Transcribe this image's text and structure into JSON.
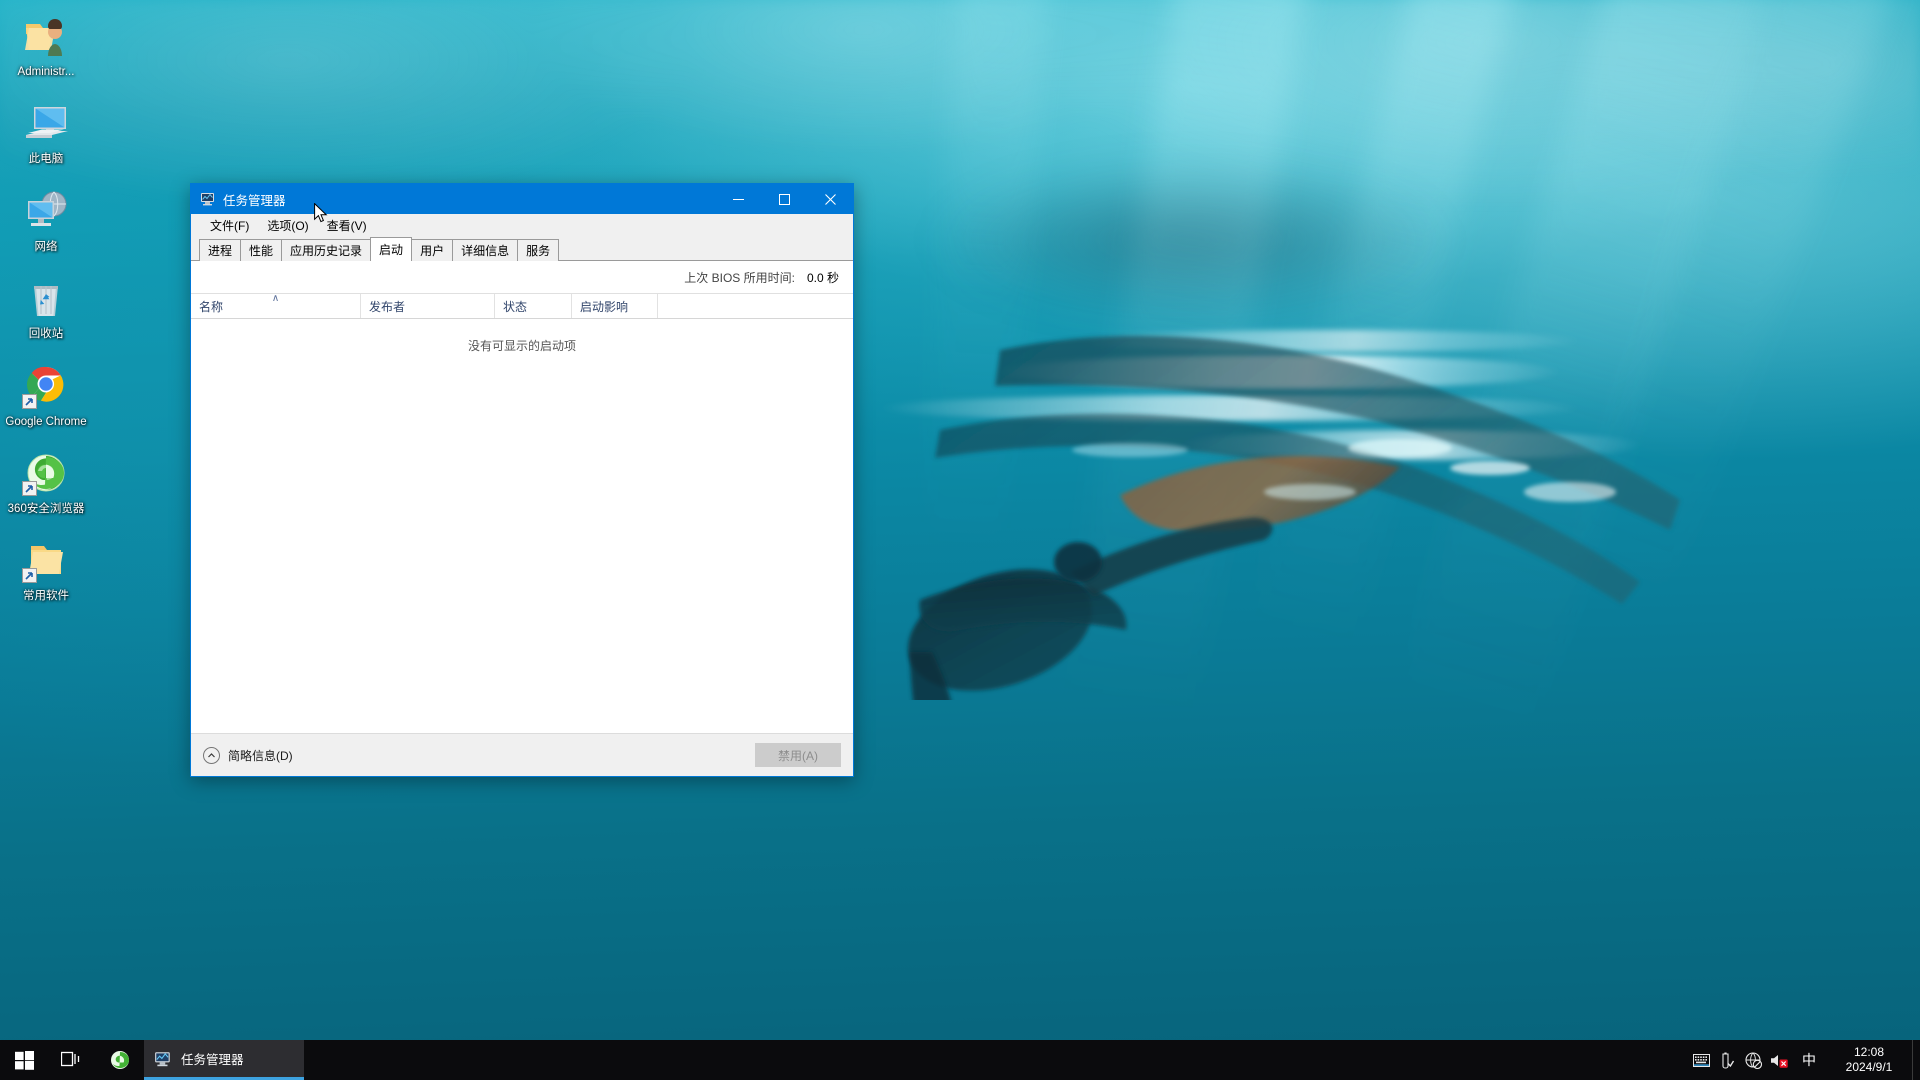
{
  "desktop": {
    "icons": [
      {
        "label": "Administr...",
        "icon": "user-folder-icon",
        "shortcut": false
      },
      {
        "label": "此电脑",
        "icon": "this-pc-icon",
        "shortcut": false
      },
      {
        "label": "网络",
        "icon": "network-icon",
        "shortcut": false
      },
      {
        "label": "回收站",
        "icon": "recycle-bin-icon",
        "shortcut": false
      },
      {
        "label": "Google Chrome",
        "icon": "chrome-icon",
        "shortcut": true
      },
      {
        "label": "360安全浏览器",
        "icon": "browser-360-icon",
        "shortcut": true
      },
      {
        "label": "常用软件",
        "icon": "folder-icon",
        "shortcut": true
      }
    ]
  },
  "window": {
    "title": "任务管理器",
    "icon": "task-manager-icon",
    "controls": {
      "minimize": "—",
      "maximize": "☐",
      "close": "✕"
    },
    "menu": [
      {
        "label": "文件(F)"
      },
      {
        "label": "选项(O)"
      },
      {
        "label": "查看(V)"
      }
    ],
    "tabs": [
      {
        "label": "进程",
        "active": false
      },
      {
        "label": "性能",
        "active": false
      },
      {
        "label": "应用历史记录",
        "active": false
      },
      {
        "label": "启动",
        "active": true
      },
      {
        "label": "用户",
        "active": false
      },
      {
        "label": "详细信息",
        "active": false
      },
      {
        "label": "服务",
        "active": false
      }
    ],
    "startup": {
      "bios_label": "上次 BIOS 所用时间:",
      "bios_value": "0.0 秒",
      "columns": [
        {
          "label": "名称",
          "sorted": true,
          "sort_mark": "∧"
        },
        {
          "label": "发布者",
          "sorted": false
        },
        {
          "label": "状态",
          "sorted": false
        },
        {
          "label": "启动影响",
          "sorted": false
        }
      ],
      "rows": [],
      "empty_message": "没有可显示的启动项"
    },
    "statusbar": {
      "fewer_details_label": "简略信息(D)",
      "fewer_details_icon": "chevron-up-circle-icon",
      "disable_button_label": "禁用(A)",
      "disable_button_enabled": false
    }
  },
  "taskbar": {
    "start_icon": "windows-start-icon",
    "task_view_icon": "task-view-icon",
    "pinned": [
      {
        "label": "360安全浏览器",
        "icon": "browser-360-icon"
      }
    ],
    "windows": [
      {
        "label": "任务管理器",
        "icon": "task-manager-icon",
        "active": true
      }
    ],
    "tray": [
      {
        "icon": "touch-keyboard-icon"
      },
      {
        "icon": "usb-eject-icon"
      },
      {
        "icon": "network-disconnected-icon"
      },
      {
        "icon": "volume-muted-icon"
      }
    ],
    "ime_label": "中",
    "clock_time": "12:08",
    "clock_date": "2024/9/1"
  },
  "colors": {
    "accent": "#0078d7",
    "title_bar": "#0078d7",
    "taskbar": "#0b0b0d",
    "window_chrome": "#f0f0f0",
    "header_text": "#31456b",
    "active_underline": "#3da2e0",
    "wallpaper_deep": "#07627a",
    "wallpaper_light": "#1fb4c9"
  }
}
